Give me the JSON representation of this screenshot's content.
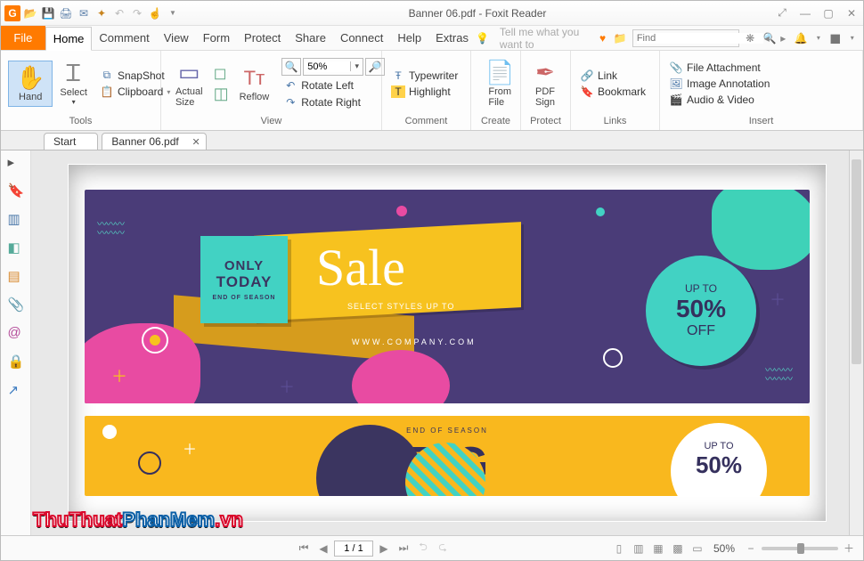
{
  "title": "Banner 06.pdf - Foxit Reader",
  "menu": {
    "file": "File",
    "tabs": [
      "Home",
      "Comment",
      "View",
      "Form",
      "Protect",
      "Share",
      "Connect",
      "Help",
      "Extras"
    ],
    "tell": "Tell me what you want to",
    "find": "Find"
  },
  "ribbon": {
    "tools": {
      "label": "Tools",
      "hand": "Hand",
      "select": "Select",
      "snapshot": "SnapShot",
      "clipboard": "Clipboard"
    },
    "view": {
      "label": "View",
      "actual": "Actual\nSize",
      "reflow": "Reflow",
      "zoom": "50%",
      "rotate_left": "Rotate Left",
      "rotate_right": "Rotate Right"
    },
    "comment": {
      "label": "Comment",
      "typewriter": "Typewriter",
      "highlight": "Highlight"
    },
    "create": {
      "label": "Create",
      "fromfile": "From\nFile"
    },
    "protect": {
      "label": "Protect",
      "pdfsign": "PDF\nSign"
    },
    "links": {
      "label": "Links",
      "link": "Link",
      "bookmark": "Bookmark"
    },
    "insert": {
      "label": "Insert",
      "file": "File Attachment",
      "image": "Image Annotation",
      "audio": "Audio & Video"
    }
  },
  "doctabs": {
    "start": "Start",
    "doc": "Banner 06.pdf"
  },
  "banner1": {
    "only": "ONLY",
    "today": "TODAY",
    "end": "END OF SEASON",
    "sale": "Sale",
    "sub": "SELECT STYLES UP TO",
    "company": "WWW.COMPANY.COM",
    "up": "UP TO",
    "pct": "50%",
    "off": "OFF"
  },
  "banner2": {
    "end": "END OF SEASON",
    "big": "BIG",
    "up": "UP TO",
    "pct": "50%"
  },
  "status": {
    "page": "1 / 1",
    "zoom": "50%"
  },
  "watermark": {
    "p1": "ThuThuat",
    "p2": "PhanMem",
    "p3": ".vn"
  }
}
